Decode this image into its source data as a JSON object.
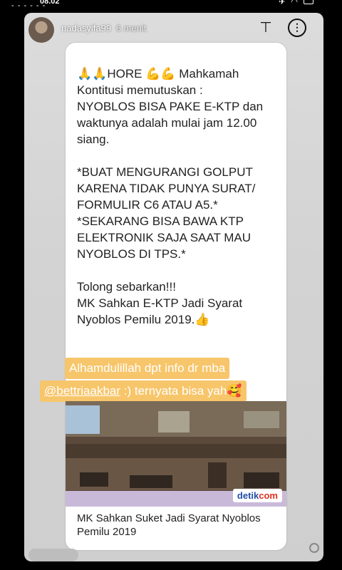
{
  "status_bar": {
    "time": "08.02"
  },
  "story_header": {
    "username": "nadasyifa99",
    "time_ago": "6 menit"
  },
  "message": {
    "text": "🙏🙏HORE 💪💪 Mahkamah Kontitusi memutuskan :\nNYOBLOS BISA PAKE E-KTP dan waktunya adalah mulai jam 12.00 siang.\n\n*BUAT MENGURANGI GOLPUT KARENA TIDAK  PUNYA SURAT/ FORMULIR C6 ATAU A5.*\n*SEKARANG BISA BAWA KTP ELEKTRONIK SAJA SAAT MAU NYOBLOS DI TPS.*\n\nTolong sebarkan!!!\nMK Sahkan E-KTP Jadi Syarat Nyoblos Pemilu 2019.👍"
  },
  "caption_highlight": {
    "line1": "Alhamdulillah dpt info dr mba",
    "mention": "@bettriaakbar",
    "line2_rest": " :) ternyata bisa yah🥰"
  },
  "link_preview": {
    "brand_main": "detik",
    "brand_accent": "com",
    "title": "MK Sahkan Suket Jadi Syarat Nyoblos Pemilu 2019"
  },
  "colors": {
    "highlight": "#f7c56a",
    "bubble": "#ffffff"
  }
}
